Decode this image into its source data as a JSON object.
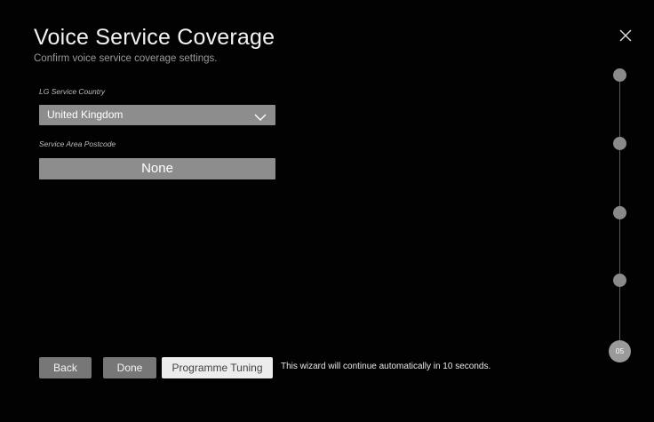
{
  "header": {
    "title": "Voice Service Coverage",
    "subtitle": "Confirm voice service coverage settings.",
    "close_icon": "close-icon"
  },
  "form": {
    "country_label": "LG Service Country",
    "country_value": "United Kingdom",
    "postcode_label": "Service Area Postcode",
    "postcode_value": "None"
  },
  "progress": {
    "total_steps": 5,
    "current_step_label": "05"
  },
  "footer": {
    "back_label": "Back",
    "done_label": "Done",
    "programme_tuning_label": "Programme Tuning",
    "auto_continue_message": "This wizard will continue automatically in 10 seconds."
  },
  "colors": {
    "background": "#020202",
    "field_bg": "#8d8d8d",
    "button_bg": "#777777",
    "primary_button_bg": "#ececec",
    "step_dot": "#8a8a8a"
  }
}
